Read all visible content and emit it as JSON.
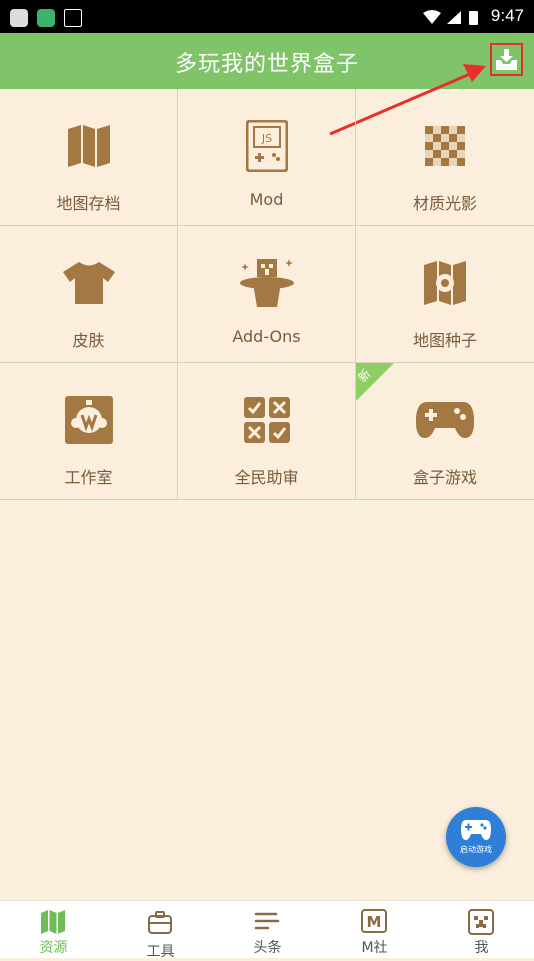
{
  "status_bar": {
    "time": "9:47"
  },
  "header": {
    "title": "多玩我的世界盒子"
  },
  "grid": {
    "items": [
      {
        "label": "地图存档",
        "icon": "map-icon"
      },
      {
        "label": "Mod",
        "icon": "mod-js-icon",
        "icon_text": "JS"
      },
      {
        "label": "材质光影",
        "icon": "texture-icon"
      },
      {
        "label": "皮肤",
        "icon": "shirt-icon"
      },
      {
        "label": "Add-Ons",
        "icon": "magic-hat-icon"
      },
      {
        "label": "地图种子",
        "icon": "map-seed-icon"
      },
      {
        "label": "工作室",
        "icon": "workshop-icon"
      },
      {
        "label": "全民助审",
        "icon": "review-icon"
      },
      {
        "label": "盒子游戏",
        "icon": "gamepad-icon",
        "badge": "新"
      }
    ]
  },
  "fab": {
    "label": "启动游戏"
  },
  "tabbar": {
    "tabs": [
      {
        "label": "资源",
        "active": true
      },
      {
        "label": "工具",
        "active": false
      },
      {
        "label": "头条",
        "active": false
      },
      {
        "label": "M社",
        "active": false,
        "icon_text": "M"
      },
      {
        "label": "我",
        "active": false
      }
    ]
  },
  "colors": {
    "header": "#80c46a",
    "background": "#fbeedc",
    "icon": "#a37843",
    "accent_red": "#e8302a",
    "tab_active": "#6fbd54"
  }
}
